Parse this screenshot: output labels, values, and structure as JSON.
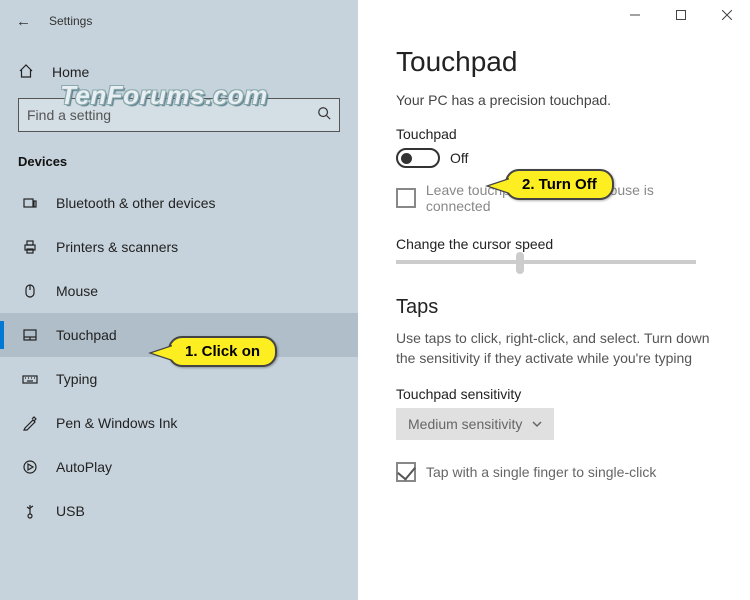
{
  "window": {
    "title": "Settings"
  },
  "watermark": "TenForums.com",
  "sidebar": {
    "home_label": "Home",
    "search_placeholder": "Find a setting",
    "section_header": "Devices",
    "items": [
      {
        "label": "Bluetooth & other devices"
      },
      {
        "label": "Printers & scanners"
      },
      {
        "label": "Mouse"
      },
      {
        "label": "Touchpad"
      },
      {
        "label": "Typing"
      },
      {
        "label": "Pen & Windows Ink"
      },
      {
        "label": "AutoPlay"
      },
      {
        "label": "USB"
      }
    ]
  },
  "main": {
    "title": "Touchpad",
    "description": "Your PC has a precision touchpad.",
    "toggle_label": "Touchpad",
    "toggle_state": "Off",
    "leave_on_label": "Leave touchpad on when a mouse is connected",
    "cursor_speed_label": "Change the cursor speed",
    "taps_title": "Taps",
    "taps_desc": "Use taps to click, right-click, and select. Turn down the sensitivity if they activate while you're typing",
    "sensitivity_label": "Touchpad sensitivity",
    "sensitivity_value": "Medium sensitivity",
    "single_tap_label": "Tap with a single finger to single-click"
  },
  "callouts": {
    "c1": "1. Click on",
    "c2": "2. Turn Off"
  }
}
